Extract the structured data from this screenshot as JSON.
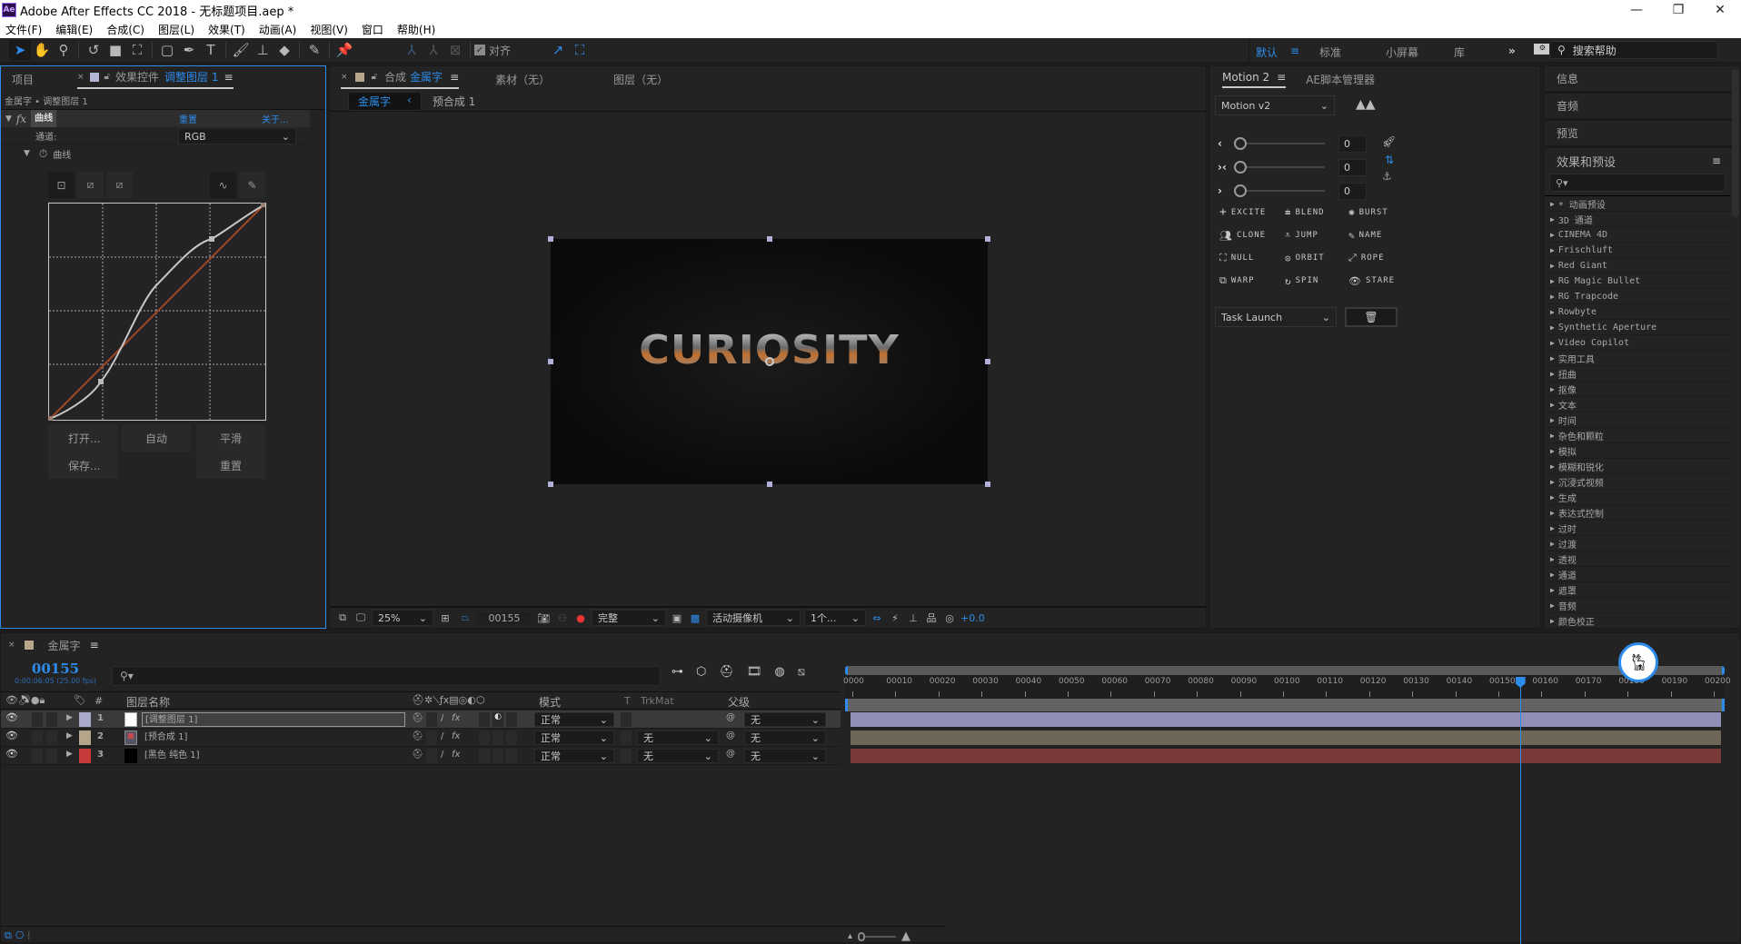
{
  "window": {
    "app_icon": "Ae",
    "title": "Adobe After Effects CC 2018 - 无标题项目.aep *",
    "controls": [
      "minimize-icon",
      "restore-icon",
      "close-icon"
    ]
  },
  "menu": [
    "文件(F)",
    "编辑(E)",
    "合成(C)",
    "图层(L)",
    "效果(T)",
    "动画(A)",
    "视图(V)",
    "窗口",
    "帮助(H)"
  ],
  "toolbar": {
    "tools": [
      "selection-tool",
      "hand-tool",
      "zoom-tool",
      "rotate-tool",
      "camera-tool",
      "pan-behind-tool",
      "rectangle-tool",
      "pen-tool",
      "text-tool",
      "brush-tool",
      "clone-stamp-tool",
      "eraser-tool",
      "roto-brush-tool",
      "puppet-pin-tool"
    ],
    "snap_label": "对齐",
    "snap_checked": true,
    "workspaces": {
      "active": "默认",
      "others": [
        "标准",
        "小屏幕",
        "库"
      ]
    },
    "more": "»",
    "search_placeholder": "搜索帮助"
  },
  "left_panel": {
    "tab_project": "项目",
    "tab_effects_prefix": "效果控件",
    "tab_effects_layer": "调整图层 1",
    "breadcrumb": "金属字 • 调整图层 1",
    "effect": {
      "name": "曲线",
      "reset": "重置",
      "about": "关于...",
      "channel_label": "通道:",
      "channel_value": "RGB",
      "curves_group": "曲线",
      "buttons": {
        "open": "打开...",
        "auto": "自动",
        "smooth": "平滑",
        "save": "保存...",
        "reset": "重置"
      }
    }
  },
  "comp_panel": {
    "tab_prefix": "合成",
    "tab_comp": "金属字",
    "tab_footage": "素材（无）",
    "tab_layer": "图层（无）",
    "breadcrumb_active": "金属字",
    "breadcrumb_next": "预合成 1",
    "preview_text": "CURIOSITY",
    "footer": {
      "zoom": "25%",
      "frame": "00155",
      "resolution": "完整",
      "camera": "活动摄像机",
      "views": "1个...",
      "exposure": "+0.0"
    }
  },
  "motion_panel": {
    "tab": "Motion 2",
    "tab2": "AE脚本管理器",
    "preset": "Motion v2",
    "sliders": [
      {
        "icon": "ease-in-icon",
        "value": "0"
      },
      {
        "icon": "ease-both-icon",
        "value": "0"
      },
      {
        "icon": "ease-out-icon",
        "value": "0"
      }
    ],
    "buttons": [
      "EXCITE",
      "BLEND",
      "BURST",
      "CLONE",
      "JUMP",
      "NAME",
      "NULL",
      "ORBIT",
      "ROPE",
      "WARP",
      "SPIN",
      "STARE"
    ],
    "task": "Task Launch"
  },
  "right_panel": {
    "sections": [
      "信息",
      "音频",
      "预览"
    ],
    "effects_title": "效果和预设",
    "effects": [
      "* 动画预设",
      "3D 通道",
      "CINEMA 4D",
      "Frischluft",
      "Red Giant",
      "RG Magic Bullet",
      "RG Trapcode",
      "Rowbyte",
      "Synthetic Aperture",
      "Video Copilot",
      "实用工具",
      "扭曲",
      "抠像",
      "文本",
      "时间",
      "杂色和颗粒",
      "模拟",
      "模糊和锐化",
      "沉浸式视频",
      "生成",
      "表达式控制",
      "过时",
      "过渡",
      "透视",
      "通道",
      "遮罩",
      "音频",
      "颜色校正"
    ]
  },
  "timeline": {
    "tab": "金属字",
    "current_frame": "00155",
    "timecode": "0:00:06:05 (25.00 fps)",
    "columns": {
      "name": "图层名称",
      "mode": "模式",
      "t": "T",
      "trkmat": "TrkMat",
      "parent": "父级",
      "num": "#"
    },
    "layers": [
      {
        "num": "1",
        "name": "[调整图层 1]",
        "label_color": "#a9a9cc",
        "mode": "正常",
        "trkmat": "",
        "parent": "无",
        "bar_color": "#8f8fb8",
        "selected": true
      },
      {
        "num": "2",
        "name": "[预合成 1]",
        "label_color": "#b5a58a",
        "mode": "正常",
        "trkmat": "无",
        "parent": "无",
        "bar_color": "#6e6657",
        "selected": false
      },
      {
        "num": "3",
        "name": "[黑色 纯色 1]",
        "label_color": "#c83a3a",
        "mode": "正常",
        "trkmat": "无",
        "parent": "无",
        "bar_color": "#7a3a3a",
        "selected": false
      }
    ],
    "ruler": [
      "0000",
      "00010",
      "00020",
      "00030",
      "00040",
      "00050",
      "00060",
      "00070",
      "00080",
      "00090",
      "00100",
      "00110",
      "00120",
      "00130",
      "00140",
      "00150",
      "00160",
      "00170",
      "00180",
      "00190",
      "00200"
    ],
    "playhead_frame": 155,
    "total_frames": 200
  },
  "colors": {
    "accent": "#2d8ceb",
    "panel": "#232323",
    "bg": "#1d1d1d"
  }
}
